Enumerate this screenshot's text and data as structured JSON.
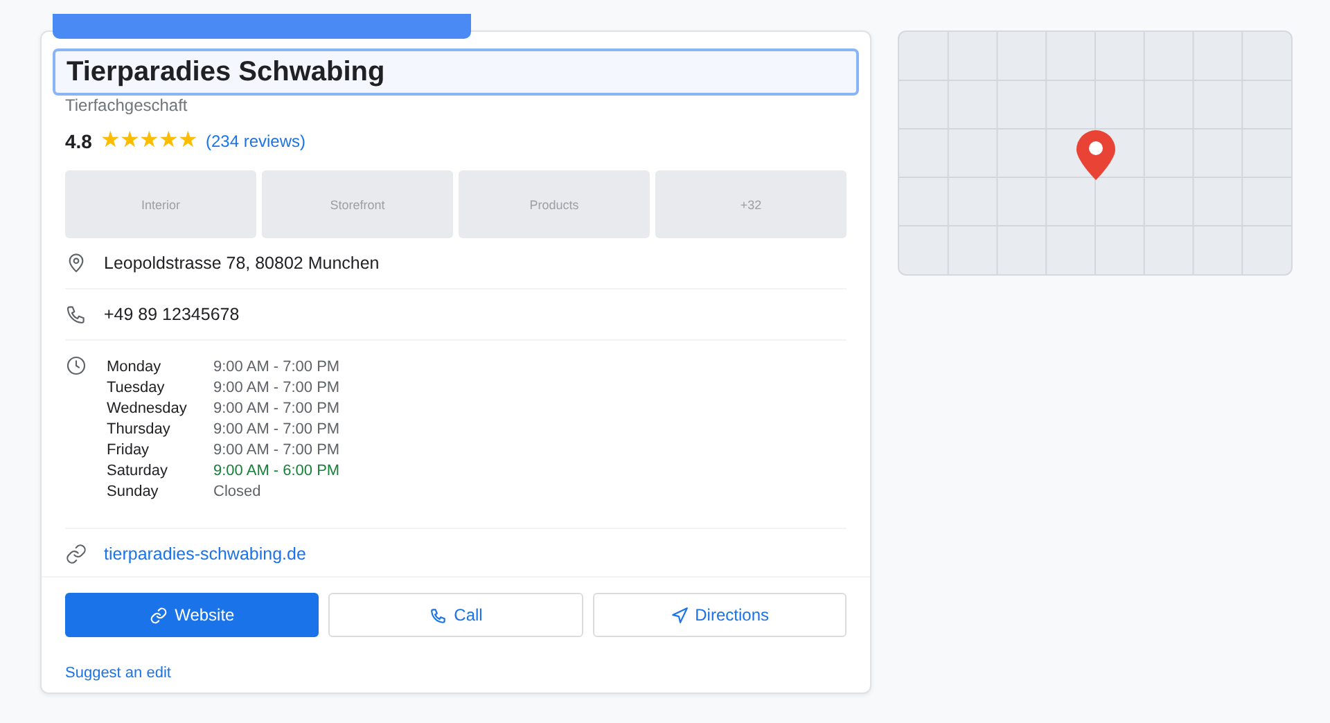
{
  "banner": {
    "kind": "tab"
  },
  "business": {
    "name": "Tierparadies Schwabing",
    "category": "Tierfachgeschaft",
    "rating": "4.8",
    "stars": 5,
    "reviews": "(234 reviews)"
  },
  "photos": [
    "Interior",
    "Storefront",
    "Products",
    "+32"
  ],
  "address": "Leopoldstrasse 78, 80802 Munchen",
  "phone": "+49 89 12345678",
  "hours": [
    {
      "day": "Monday",
      "time": "9:00 AM - 7:00 PM",
      "current": false
    },
    {
      "day": "Tuesday",
      "time": "9:00 AM - 7:00 PM",
      "current": false
    },
    {
      "day": "Wednesday",
      "time": "9:00 AM - 7:00 PM",
      "current": false
    },
    {
      "day": "Thursday",
      "time": "9:00 AM - 7:00 PM",
      "current": false
    },
    {
      "day": "Friday",
      "time": "9:00 AM - 7:00 PM",
      "current": false
    },
    {
      "day": "Saturday",
      "time": "9:00 AM - 6:00 PM",
      "current": true
    },
    {
      "day": "Sunday",
      "time": "Closed",
      "current": false
    }
  ],
  "website": "tierparadies-schwabing.de",
  "actions": [
    {
      "label": "Website",
      "kind": "link",
      "primary": true
    },
    {
      "label": "Call",
      "kind": "phone",
      "primary": false
    },
    {
      "label": "Directions",
      "kind": "directions",
      "primary": false
    }
  ],
  "suggest_edit": "Suggest an edit"
}
